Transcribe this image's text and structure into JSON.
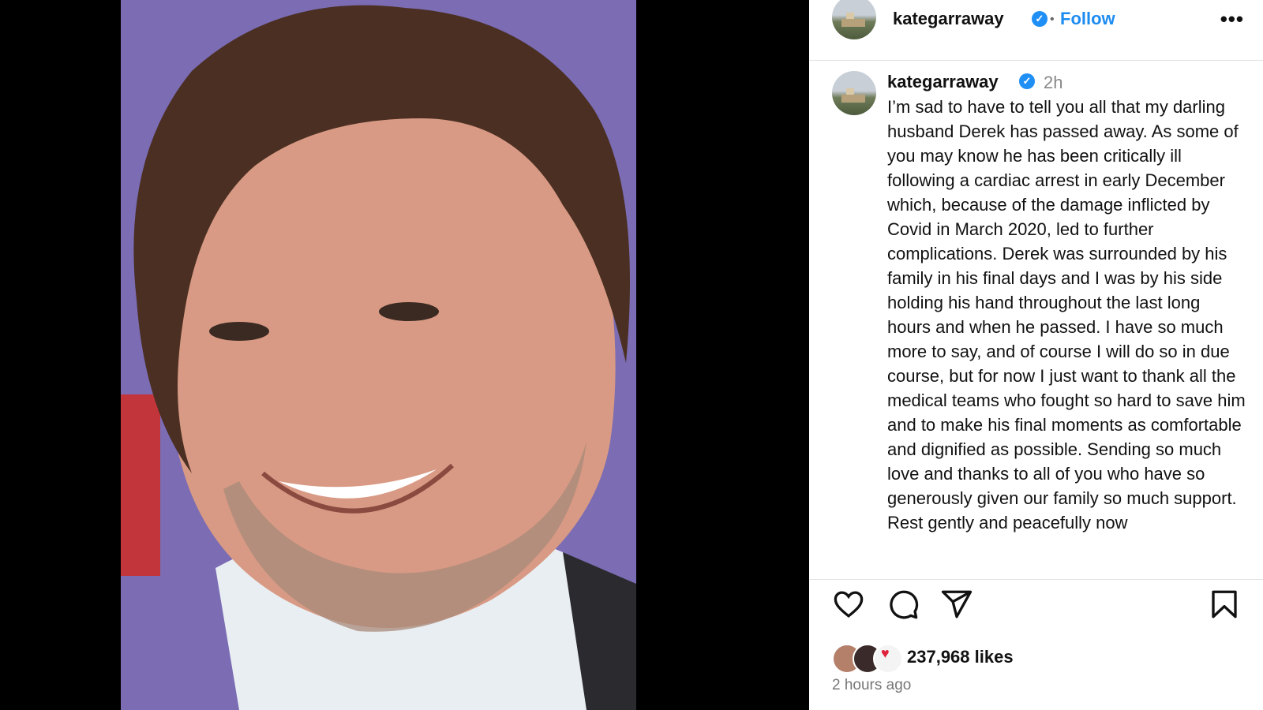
{
  "post": {
    "username": "kategarraway",
    "verified_icon": "verified-badge-icon",
    "follow_label": "Follow",
    "separator": "•",
    "more_label": "•••"
  },
  "caption": {
    "username": "kategarraway",
    "time": "2h",
    "text": "I’m sad to have to tell you all that my darling husband Derek has passed away. As some of you may know he has been critically ill following a cardiac arrest in early December which, because of the damage inflicted by Covid in March 2020, led to further complications. Derek was surrounded by his family in his final days and I was by his side holding his hand throughout the last long hours and when he passed. I have so much more to say, and of course I will do so in due course, but for now I just want to thank all the medical teams who fought so hard to save him and to make his final moments as comfortable and dignified as possible. Sending so much love and thanks to all of you who have so generously given our family so much support. Rest gently and peacefully now"
  },
  "actions": {
    "icons": [
      "heart-icon",
      "comment-icon",
      "share-icon",
      "bookmark-icon"
    ],
    "likes": "237,968 likes",
    "posted_ago": "2 hours ago"
  },
  "colors": {
    "accent": "#1d8cf0",
    "photo_background": "#7a6ab3"
  }
}
